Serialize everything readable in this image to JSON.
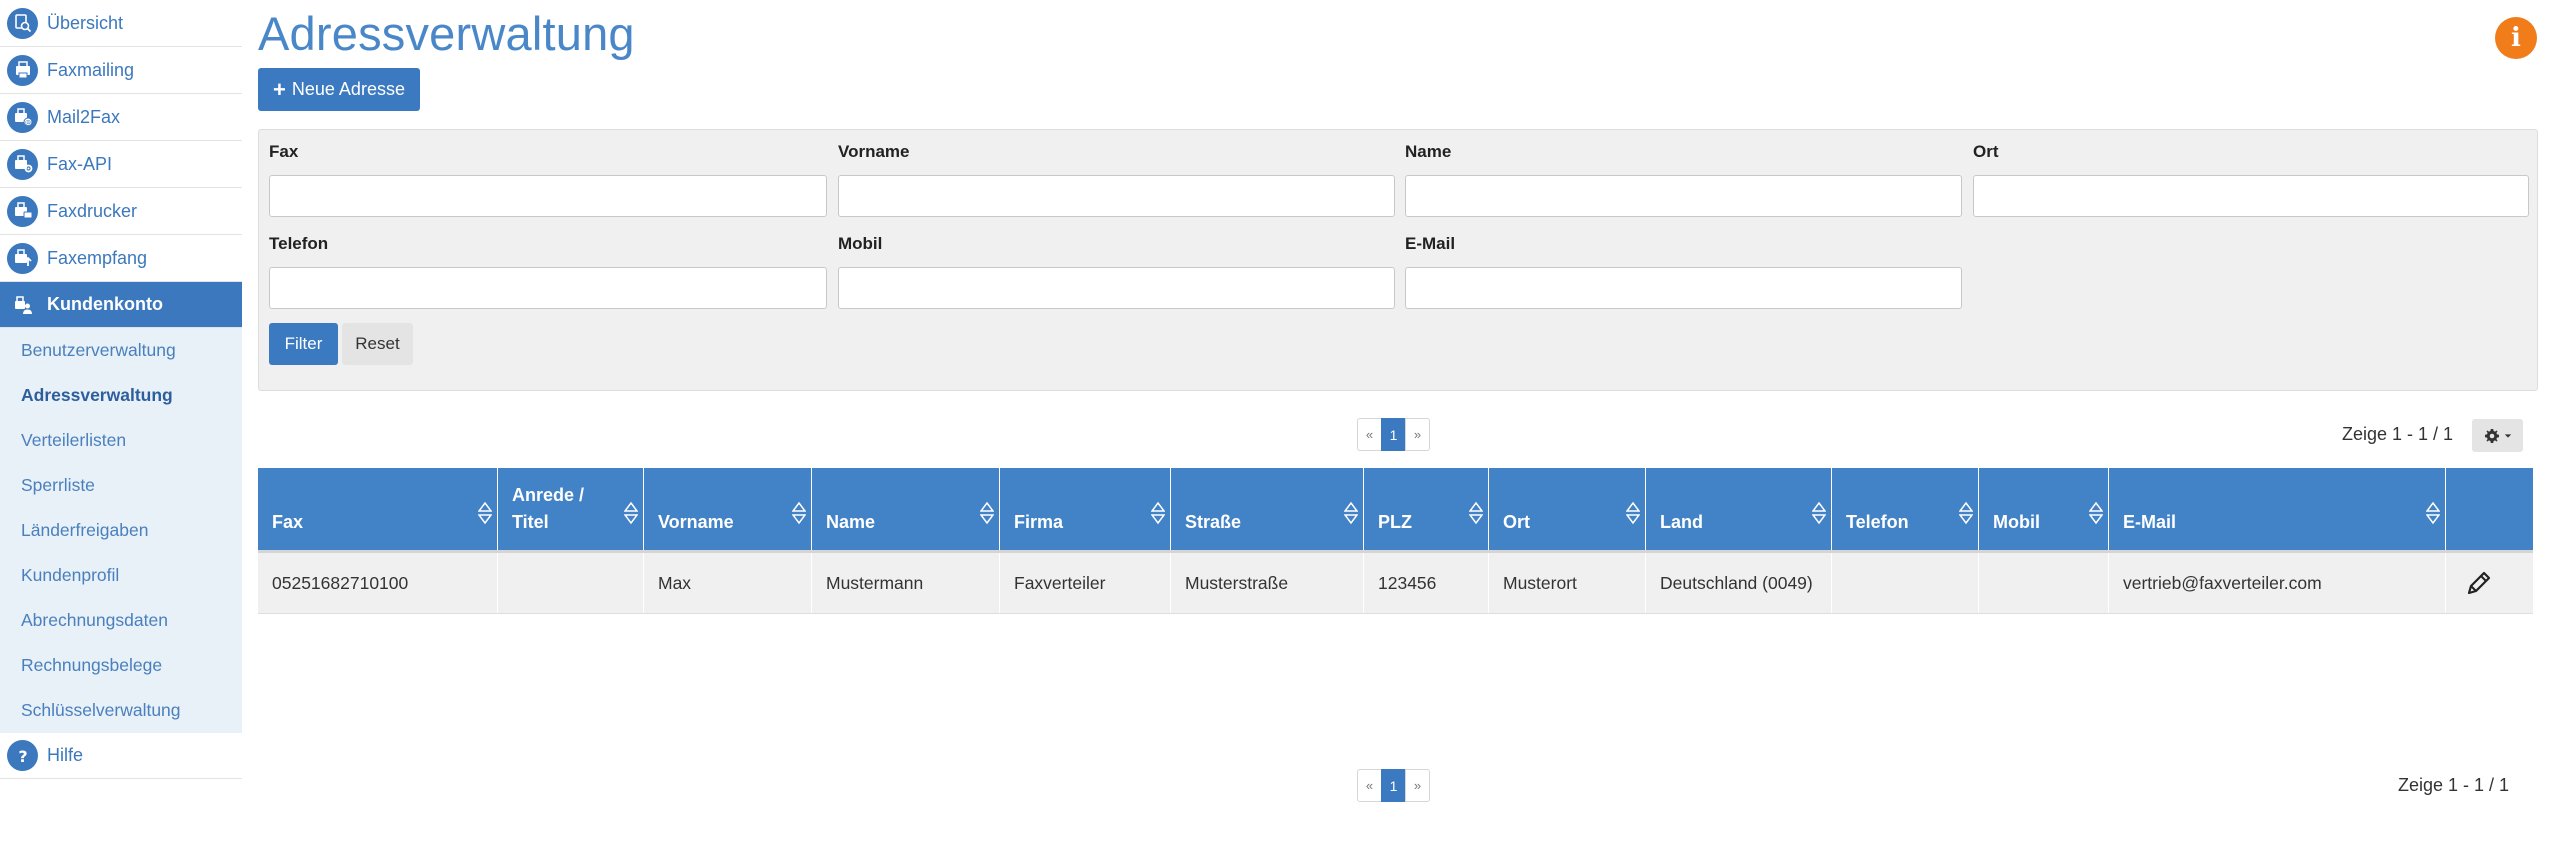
{
  "sidebar": {
    "items": [
      {
        "label": "Übersicht",
        "icon": "overview-icon"
      },
      {
        "label": "Faxmailing",
        "icon": "faxmailing-icon"
      },
      {
        "label": "Mail2Fax",
        "icon": "mail2fax-icon"
      },
      {
        "label": "Fax-API",
        "icon": "fax-api-icon"
      },
      {
        "label": "Faxdrucker",
        "icon": "faxdrucker-icon"
      },
      {
        "label": "Faxempfang",
        "icon": "faxempfang-icon"
      },
      {
        "label": "Kundenkonto",
        "icon": "kundenkonto-icon"
      }
    ],
    "subitems": [
      "Benutzerverwaltung",
      "Adressverwaltung",
      "Verteilerlisten",
      "Sperrliste",
      "Länderfreigaben",
      "Kundenprofil",
      "Abrechnungsdaten",
      "Rechnungsbelege",
      "Schlüsselverwaltung"
    ],
    "help": {
      "label": "Hilfe",
      "icon": "help-icon"
    }
  },
  "page": {
    "title": "Adressverwaltung",
    "info_glyph": "i",
    "new_button": "Neue Adresse"
  },
  "filter": {
    "labels": {
      "fax": "Fax",
      "vorname": "Vorname",
      "name": "Name",
      "ort": "Ort",
      "telefon": "Telefon",
      "mobil": "Mobil",
      "email": "E-Mail"
    },
    "values": {
      "fax": "",
      "vorname": "",
      "name": "",
      "ort": "",
      "telefon": "",
      "mobil": "",
      "email": ""
    },
    "filter_button": "Filter",
    "reset_button": "Reset"
  },
  "pagination": {
    "prev": "«",
    "current": "1",
    "next": "»",
    "showing_top": "Zeige 1 - 1 / 1",
    "showing_bottom": "Zeige 1 - 1 / 1"
  },
  "table": {
    "columns": [
      "Fax",
      "Anrede / Titel",
      "Vorname",
      "Name",
      "Firma",
      "Straße",
      "PLZ",
      "Ort",
      "Land",
      "Telefon",
      "Mobil",
      "E-Mail",
      ""
    ],
    "rows": [
      [
        "05251682710100",
        "",
        "Max",
        "Mustermann",
        "Faxverteiler",
        "Musterstraße",
        "123456",
        "Musterort",
        "Deutschland (0049)",
        "",
        "",
        "vertrieb@faxverteiler.com"
      ]
    ]
  },
  "colors": {
    "primary": "#3b7ac1",
    "header": "#4282c6",
    "title": "#4a87c8",
    "info": "#f07d1a",
    "subnav_bg": "#e8f0f8"
  }
}
